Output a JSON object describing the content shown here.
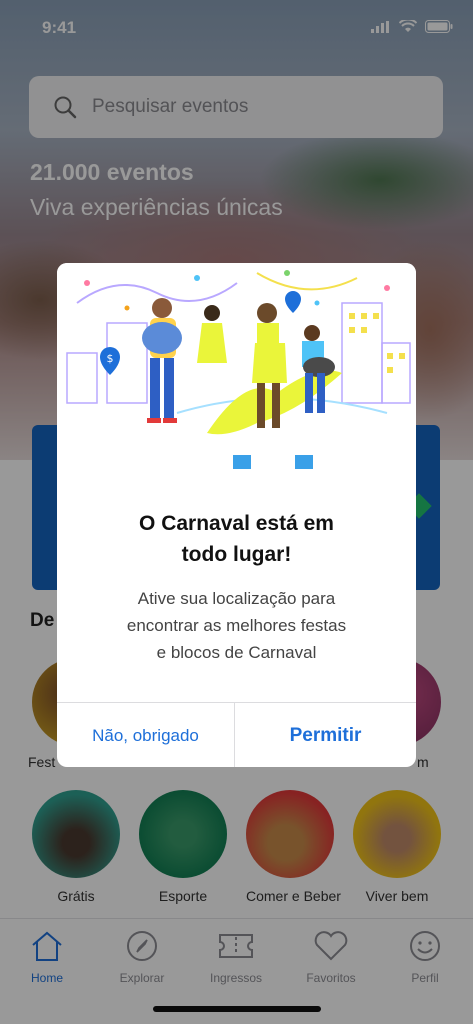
{
  "status_bar": {
    "time": "9:41"
  },
  "search": {
    "placeholder": "Pesquisar eventos"
  },
  "hero": {
    "count": "21.000 eventos",
    "subtitle": "Viva experiências únicas"
  },
  "section": {
    "title_partial": "De"
  },
  "categories_row1_partial": [
    {
      "label": "Fest"
    },
    {
      "label": "m"
    }
  ],
  "categories_row2": [
    {
      "label": "Grátis"
    },
    {
      "label": "Esporte"
    },
    {
      "label": "Comer e Beber"
    },
    {
      "label": "Viver bem"
    }
  ],
  "tabbar": {
    "items": [
      {
        "label": "Home",
        "icon": "home-icon",
        "active": true
      },
      {
        "label": "Explorar",
        "icon": "compass-icon",
        "active": false
      },
      {
        "label": "Ingressos",
        "icon": "ticket-icon",
        "active": false
      },
      {
        "label": "Favoritos",
        "icon": "heart-icon",
        "active": false
      },
      {
        "label": "Perfil",
        "icon": "profile-icon",
        "active": false
      }
    ]
  },
  "modal": {
    "title_line1": "O Carnaval está em",
    "title_line2": "todo lugar!",
    "body_line1": "Ative sua localização para",
    "body_line2": "encontrar as melhores festas",
    "body_line3": "e blocos de Carnaval",
    "decline_label": "Não, obrigado",
    "accept_label": "Permitir"
  },
  "colors": {
    "accent": "#1e6fd9",
    "banner": "#1565c0",
    "dim_overlay": "rgba(0,0,0,0.4)"
  }
}
